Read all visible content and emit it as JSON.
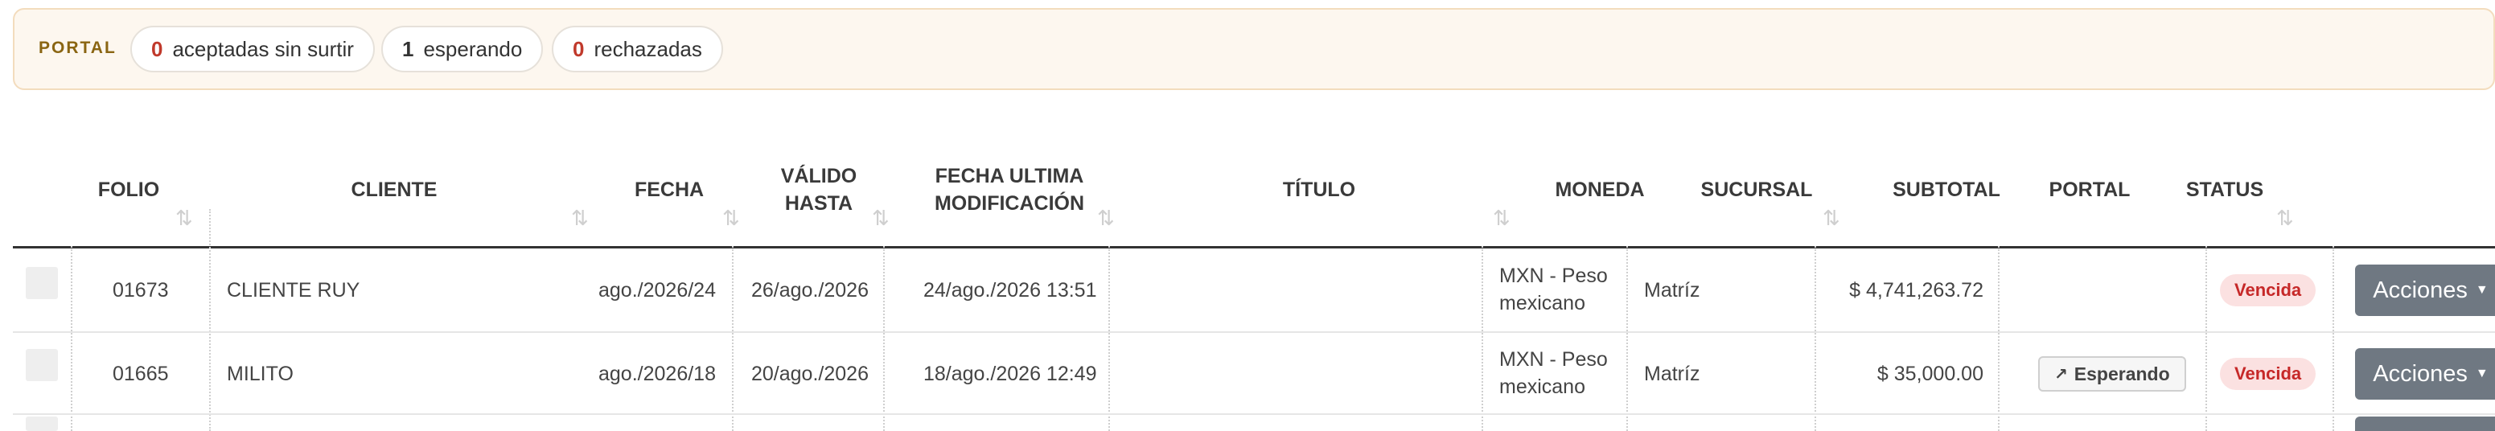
{
  "portal": {
    "title": "PORTAL",
    "stats": [
      {
        "count": "0",
        "label": "aceptadas sin surtir",
        "color": "#c0392b"
      },
      {
        "count": "1",
        "label": "esperando",
        "color": "#333333"
      },
      {
        "count": "0",
        "label": "rechazadas",
        "color": "#c0392b"
      }
    ]
  },
  "table": {
    "headers": {
      "folio": "FOLIO",
      "cliente": "CLIENTE",
      "fecha": "FECHA",
      "valido_1": "VÁLIDO",
      "valido_2": "HASTA",
      "mod_1": "FECHA ULTIMA",
      "mod_2": "MODIFICACIÓN",
      "titulo": "TÍTULO",
      "moneda": "MONEDA",
      "sucursal": "SUCURSAL",
      "subtotal": "SUBTOTAL",
      "portal": "PORTAL",
      "status": "STATUS"
    },
    "sort_icon": "⇅",
    "rows": [
      {
        "folio": "01673",
        "cliente": "CLIENTE RUY",
        "fecha": "24/ago./2026",
        "valido": "26/ago./2026",
        "modificacion": "24/ago./2026 13:51",
        "titulo": "",
        "moneda_1": "MXN - Peso",
        "moneda_2": "mexicano",
        "sucursal": "Matríz",
        "subtotal": "$ 4,741,263.72",
        "portal": "",
        "status": "Vencida",
        "acciones": "Acciones"
      },
      {
        "folio": "01665",
        "cliente": "MILITO",
        "fecha": "18/ago./2026",
        "valido": "20/ago./2026",
        "modificacion": "18/ago./2026 12:49",
        "titulo": "",
        "moneda_1": "MXN - Peso",
        "moneda_2": "mexicano",
        "sucursal": "Matríz",
        "subtotal": "$ 35,000.00",
        "portal": "Esperando",
        "status": "Vencida",
        "acciones": "Acciones"
      }
    ]
  },
  "colors": {
    "portal_bg": "#fdf7ef",
    "portal_border": "#f3dcbd",
    "badge_bg": "#fbe1e1",
    "badge_text": "#c62828",
    "acciones_bg": "#6f7882"
  }
}
